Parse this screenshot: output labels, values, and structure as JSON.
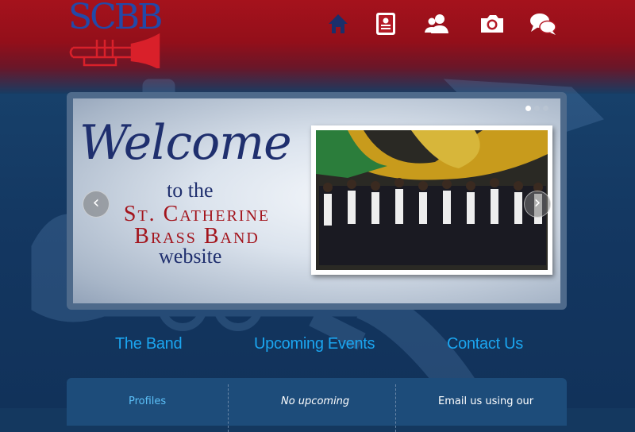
{
  "logo": {
    "text": "SCBB"
  },
  "nav": [
    {
      "name": "home",
      "icon": "home-icon"
    },
    {
      "name": "profiles",
      "icon": "contact-card-icon"
    },
    {
      "name": "members",
      "icon": "users-icon"
    },
    {
      "name": "gallery",
      "icon": "camera-icon"
    },
    {
      "name": "contact",
      "icon": "chat-bubbles-icon"
    }
  ],
  "slider": {
    "welcome": "Welcome",
    "to_the": "to the",
    "band_line1": "St. Catherine",
    "band_line2": "Brass Band",
    "website": "website",
    "prev": "‹",
    "next": "›",
    "active_slide": 1,
    "slide_count": 3
  },
  "sections": {
    "band": {
      "title": "The Band",
      "text": "Profiles"
    },
    "events": {
      "title": "Upcoming Events",
      "text": "No upcoming"
    },
    "contact": {
      "title": "Contact Us",
      "text": "Email us using our"
    }
  },
  "colors": {
    "header_red": "#a5121c",
    "background_navy": "#14385f",
    "link_blue": "#1ba6f0",
    "welcome_navy": "#1f2f6e",
    "band_red": "#a3141c"
  }
}
